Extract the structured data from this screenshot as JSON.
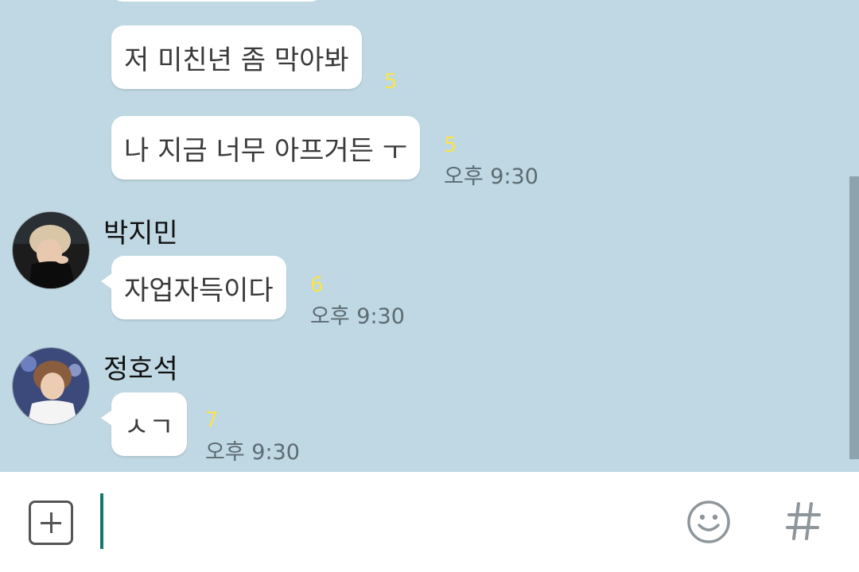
{
  "messages": [
    {
      "text": "저 미친년 좀 막아봐",
      "unread": "5"
    },
    {
      "text": "나 지금 너무 아프거든 ㅜ",
      "unread": "5",
      "time": "오후 9:30"
    },
    {
      "sender": "박지민",
      "text": "자업자득이다",
      "unread": "6",
      "time": "오후 9:30"
    },
    {
      "sender": "정호석",
      "text": "ㅅㄱ",
      "unread": "7",
      "time": "오후 9:30"
    }
  ],
  "input": {
    "value": "",
    "placeholder": ""
  },
  "icons": {
    "attach": "plus-square-icon",
    "emoji": "smiley-icon",
    "hashtag": "hashtag-icon"
  },
  "colors": {
    "chat_background": "#bfd8e3",
    "bubble": "#ffffff",
    "unread_count": "#fbe34a",
    "cursor": "#127a6c"
  }
}
